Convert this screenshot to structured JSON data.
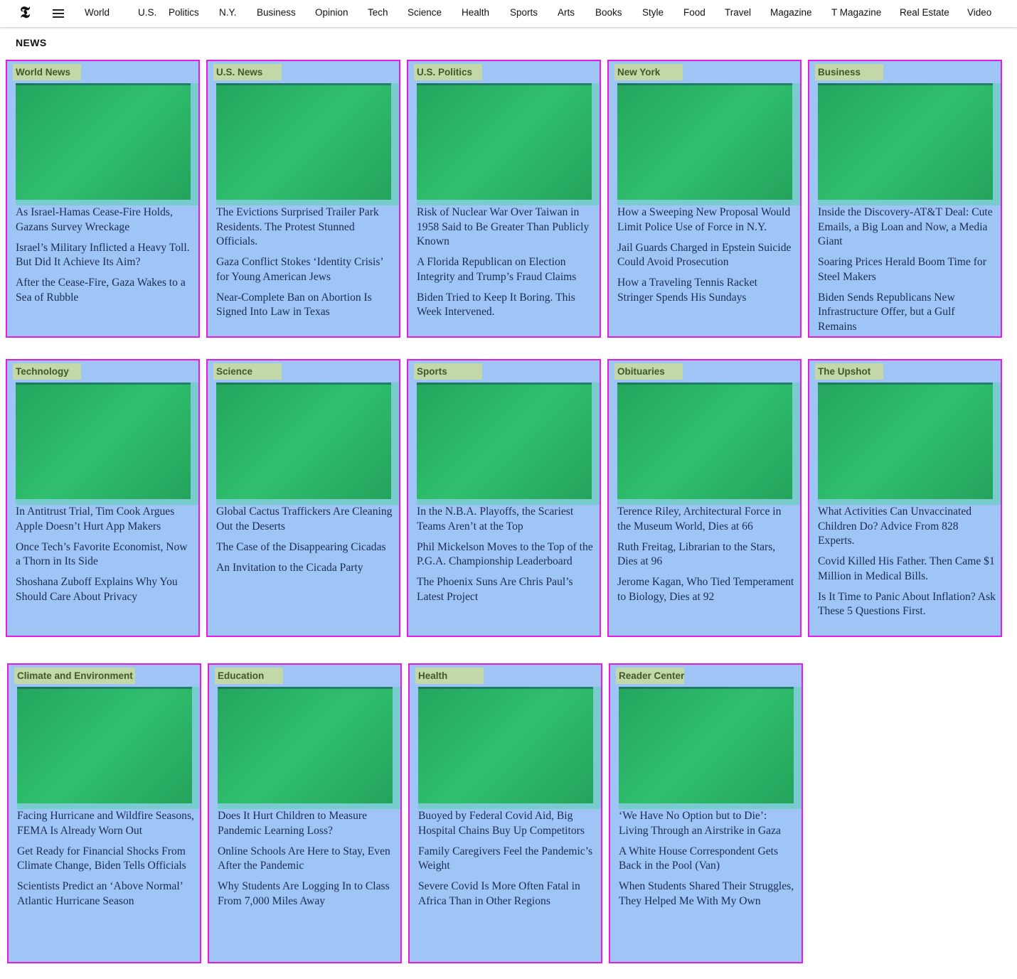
{
  "nav": {
    "logo": "𝕿",
    "links": [
      "World",
      "U.S.",
      "Politics",
      "N.Y.",
      "Business",
      "Opinion",
      "Tech",
      "Science",
      "Health",
      "Sports",
      "Arts",
      "Books",
      "Style",
      "Food",
      "Travel",
      "Magazine",
      "T Magazine",
      "Real Estate",
      "Video"
    ]
  },
  "page": {
    "section_title": "NEWS"
  },
  "colors": {
    "card_background": "#9fc4f6",
    "card_border": "#e21be8",
    "image_overlay": "#3edc82",
    "label_background": "#c2d8a8",
    "headline_text": "#1b2c52"
  },
  "sections": [
    {
      "label": "World News",
      "headlines": [
        "As Israel-Hamas Cease-Fire Holds, Gazans Survey Wreckage",
        "Israel’s Military Inflicted a Heavy Toll. But Did It Achieve Its Aim?",
        "After the Cease-Fire, Gaza Wakes to a Sea of Rubble"
      ]
    },
    {
      "label": "U.S. News",
      "headlines": [
        "The Evictions Surprised Trailer Park Residents. The Protest Stunned Officials.",
        "Gaza Conflict Stokes ‘Identity Crisis’ for Young American Jews",
        "Near-Complete Ban on Abortion Is Signed Into Law in Texas"
      ]
    },
    {
      "label": "U.S. Politics",
      "headlines": [
        "Risk of Nuclear War Over Taiwan in 1958 Said to Be Greater Than Publicly Known",
        "A Florida Republican on Election Integrity and Trump’s Fraud Claims",
        "Biden Tried to Keep It Boring. This Week Intervened."
      ]
    },
    {
      "label": "New York",
      "headlines": [
        "How a Sweeping New Proposal Would Limit Police Use of Force in N.Y.",
        "Jail Guards Charged in Epstein Suicide Could Avoid Prosecution",
        "How a Traveling Tennis Racket Stringer Spends His Sundays"
      ]
    },
    {
      "label": "Business",
      "headlines": [
        "Inside the Discovery-AT&T Deal: Cute Emails, a Big Loan and Now, a Media Giant",
        "Soaring Prices Herald Boom Time for Steel Makers",
        "Biden Sends Republicans New Infrastructure Offer, but a Gulf Remains"
      ]
    },
    {
      "label": "Technology",
      "headlines": [
        "In Antitrust Trial, Tim Cook Argues Apple Doesn’t Hurt App Makers",
        "Once Tech’s Favorite Economist, Now a Thorn in Its Side",
        "Shoshana Zuboff Explains Why You Should Care About Privacy"
      ]
    },
    {
      "label": "Science",
      "headlines": [
        "Global Cactus Traffickers Are Cleaning Out the Deserts",
        "The Case of the Disappearing Cicadas",
        "An Invitation to the Cicada Party"
      ]
    },
    {
      "label": "Sports",
      "headlines": [
        "In the N.B.A. Playoffs, the Scariest Teams Aren’t at the Top",
        "Phil Mickelson Moves to the Top of the P.G.A. Championship Leaderboard",
        "The Phoenix Suns Are Chris Paul’s Latest Project"
      ]
    },
    {
      "label": "Obituaries",
      "headlines": [
        "Terence Riley, Architectural Force in the Museum World, Dies at 66",
        "Ruth Freitag, Librarian to the Stars, Dies at 96",
        "Jerome Kagan, Who Tied Temperament to Biology, Dies at 92"
      ]
    },
    {
      "label": "The Upshot",
      "headlines": [
        "What Activities Can Unvaccinated Children Do? Advice From 828 Experts.",
        "Covid Killed His Father. Then Came $1 Million in Medical Bills.",
        "Is It Time to Panic About Inflation? Ask These 5 Questions First."
      ]
    },
    {
      "label": "Climate and Environment",
      "headlines": [
        "Facing Hurricane and Wildfire Seasons, FEMA Is Already Worn Out",
        "Get Ready for Financial Shocks From Climate Change, Biden Tells Officials",
        "Scientists Predict an ‘Above Normal’ Atlantic Hurricane Season"
      ]
    },
    {
      "label": "Education",
      "headlines": [
        "Does It Hurt Children to Measure Pandemic Learning Loss?",
        "Online Schools Are Here to Stay, Even After the Pandemic",
        "Why Students Are Logging In to Class From 7,000 Miles Away"
      ]
    },
    {
      "label": "Health",
      "headlines": [
        "Buoyed by Federal Covid Aid, Big Hospital Chains Buy Up Competitors",
        "Family Caregivers Feel the Pandemic’s Weight",
        "Severe Covid Is More Often Fatal in Africa Than in Other Regions"
      ]
    },
    {
      "label": "Reader Center",
      "headlines": [
        "‘We Have No Option but to Die’: Living Through an Airstrike in Gaza",
        "A White House Correspondent Gets Back in the Pool (Van)",
        "When Students Shared Their Struggles, They Helped Me With My Own"
      ]
    }
  ]
}
